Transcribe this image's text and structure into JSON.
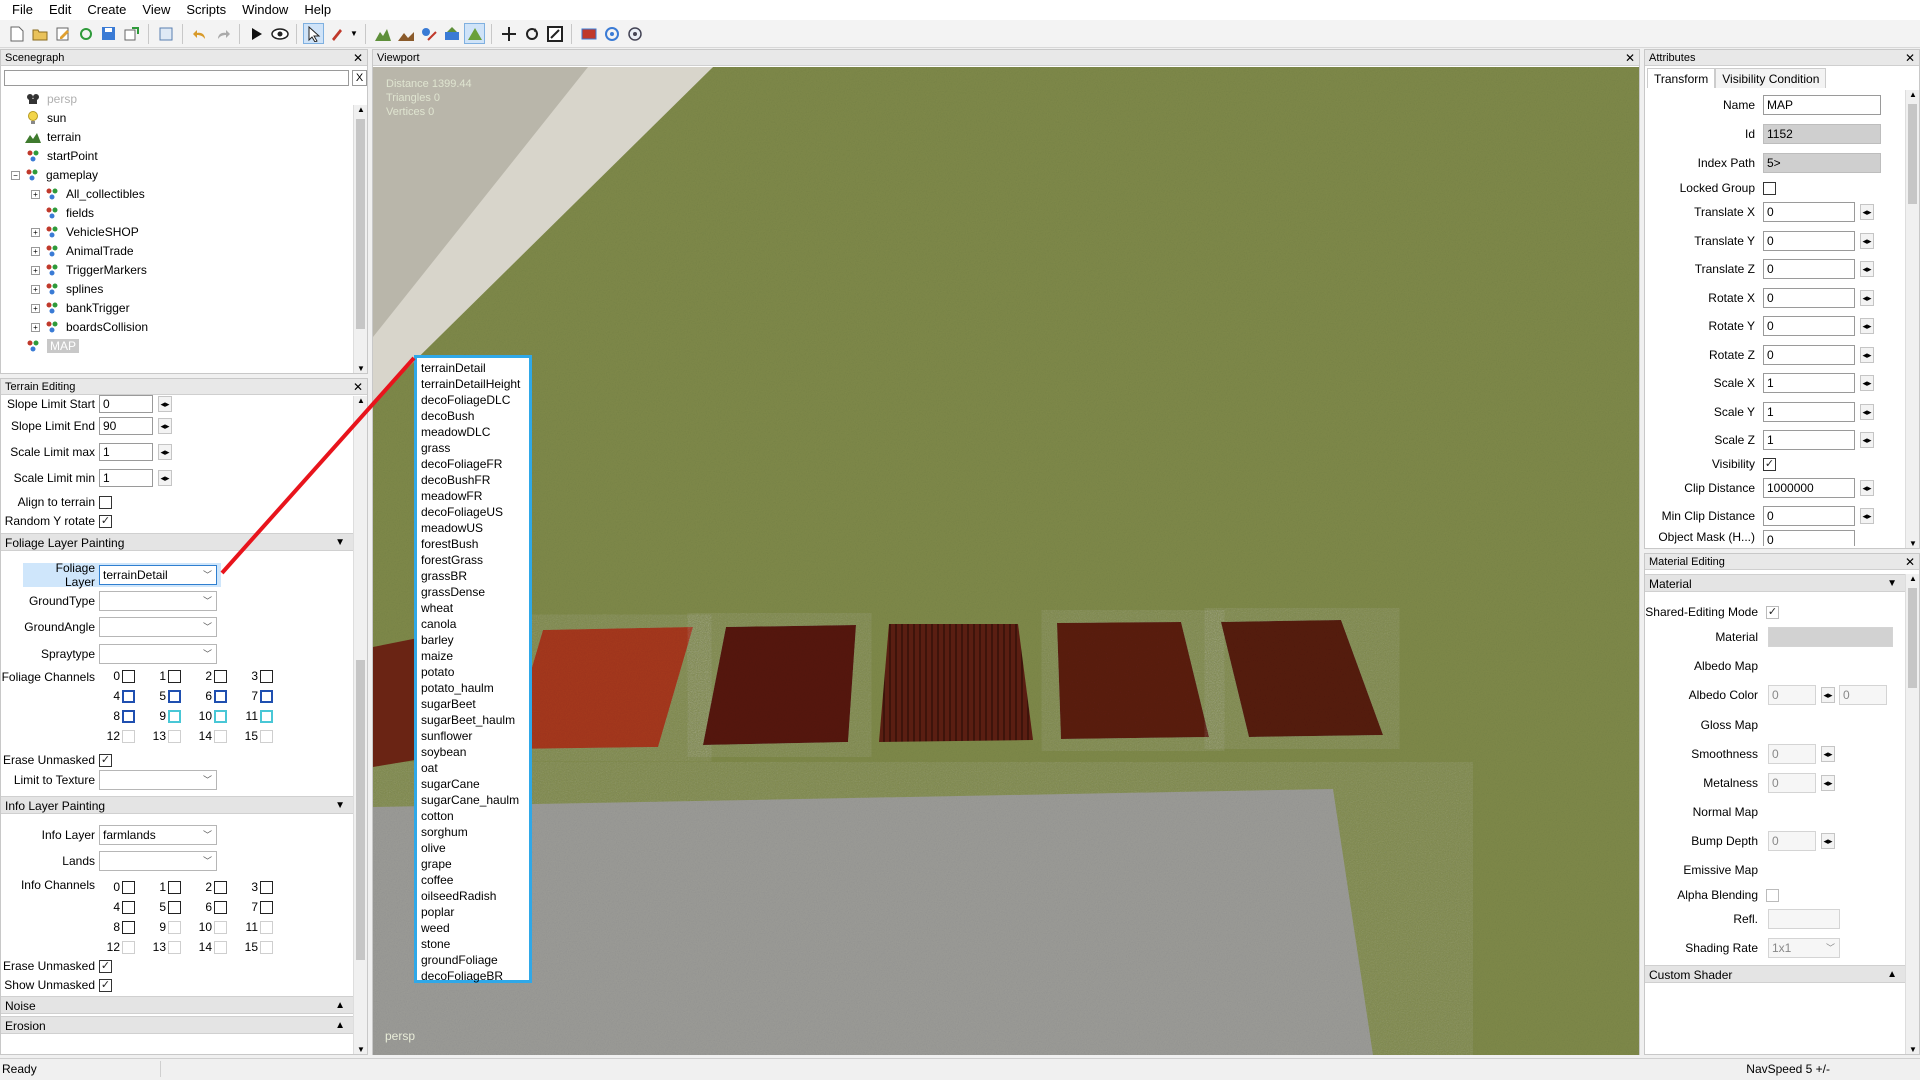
{
  "menu": [
    "File",
    "Edit",
    "Create",
    "View",
    "Scripts",
    "Window",
    "Help"
  ],
  "panels": {
    "scenegraph": "Scenegraph",
    "terrain_editing": "Terrain Editing",
    "viewport": "Viewport",
    "attributes": "Attributes",
    "material_editing": "Material Editing"
  },
  "scenegraph": {
    "clear_label": "X",
    "nodes": [
      "persp",
      "sun",
      "terrain",
      "startPoint",
      "gameplay",
      "All_collectibles",
      "fields",
      "VehicleSHOP",
      "AnimalTrade",
      "TriggerMarkers",
      "splines",
      "bankTrigger",
      "boardsCollision",
      "MAP"
    ]
  },
  "terrain": {
    "slope_limit_start": {
      "label": "Slope Limit Start",
      "value": "0"
    },
    "slope_limit_end": {
      "label": "Slope Limit End",
      "value": "90"
    },
    "scale_limit_max": {
      "label": "Scale Limit max",
      "value": "1"
    },
    "scale_limit_min": {
      "label": "Scale Limit min",
      "value": "1"
    },
    "align_to_terrain": "Align to terrain",
    "random_y_rotate": "Random Y rotate",
    "foliage_section": "Foliage Layer Painting",
    "foliage_layer": {
      "label": "Foliage Layer",
      "value": "terrainDetail"
    },
    "ground_type": "GroundType",
    "ground_angle": "GroundAngle",
    "spray_type": "Spraytype",
    "foliage_channels": "Foliage Channels",
    "erase_unmasked": "Erase Unmasked",
    "limit_to_texture": "Limit to Texture",
    "info_section": "Info Layer Painting",
    "info_layer": {
      "label": "Info Layer",
      "value": "farmlands"
    },
    "lands": "Lands",
    "info_channels": "Info Channels",
    "info_erase_unmasked": "Erase Unmasked",
    "show_unmasked": "Show Unmasked",
    "noise_section": "Noise",
    "erosion_section": "Erosion",
    "channel_numbers": [
      "0",
      "1",
      "2",
      "3",
      "4",
      "5",
      "6",
      "7",
      "8",
      "9",
      "10",
      "11",
      "12",
      "13",
      "14",
      "15"
    ]
  },
  "viewport": {
    "distance": "Distance 1399.44",
    "triangles": "Triangles 0",
    "vertices": "Vertices 0",
    "camera": "persp"
  },
  "foliage_options": [
    "terrainDetail",
    "terrainDetailHeight",
    "decoFoliageDLC",
    "decoBush",
    "meadowDLC",
    "grass",
    "decoFoliageFR",
    "decoBushFR",
    "meadowFR",
    "decoFoliageUS",
    "meadowUS",
    "forestBush",
    "forestGrass",
    "grassBR",
    "grassDense",
    "wheat",
    "canola",
    "barley",
    "maize",
    "potato",
    "potato_haulm",
    "sugarBeet",
    "sugarBeet_haulm",
    "sunflower",
    "soybean",
    "oat",
    "sugarCane",
    "sugarCane_haulm",
    "cotton",
    "sorghum",
    "olive",
    "grape",
    "coffee",
    "oilseedRadish",
    "poplar",
    "weed",
    "stone",
    "groundFoliage",
    "decoFoliageBR"
  ],
  "attributes": {
    "tabs": [
      "Transform",
      "Visibility Condition"
    ],
    "name": {
      "label": "Name",
      "value": "MAP"
    },
    "id": {
      "label": "Id",
      "value": "1152"
    },
    "index_path": {
      "label": "Index Path",
      "value": "5>"
    },
    "locked_group": "Locked Group",
    "translate_x": {
      "label": "Translate X",
      "value": "0"
    },
    "translate_y": {
      "label": "Translate Y",
      "value": "0"
    },
    "translate_z": {
      "label": "Translate Z",
      "value": "0"
    },
    "rotate_x": {
      "label": "Rotate X",
      "value": "0"
    },
    "rotate_y": {
      "label": "Rotate Y",
      "value": "0"
    },
    "rotate_z": {
      "label": "Rotate Z",
      "value": "0"
    },
    "scale_x": {
      "label": "Scale X",
      "value": "1"
    },
    "scale_y": {
      "label": "Scale Y",
      "value": "1"
    },
    "scale_z": {
      "label": "Scale Z",
      "value": "1"
    },
    "visibility": "Visibility",
    "clip_distance": {
      "label": "Clip Distance",
      "value": "1000000"
    },
    "min_clip_distance": {
      "label": "Min Clip Distance",
      "value": "0"
    },
    "object_mask": {
      "label": "Object Mask (H...)",
      "value": "0"
    }
  },
  "material": {
    "section": "Material",
    "shared_editing": "Shared-Editing Mode",
    "material": "Material",
    "albedo_map": "Albedo Map",
    "albedo_color": {
      "label": "Albedo Color",
      "value1": "0",
      "value2": "0"
    },
    "gloss_map": "Gloss Map",
    "smoothness": {
      "label": "Smoothness",
      "value": "0"
    },
    "metalness": {
      "label": "Metalness",
      "value": "0"
    },
    "normal_map": "Normal Map",
    "bump_depth": {
      "label": "Bump Depth",
      "value": "0"
    },
    "emissive_map": "Emissive Map",
    "alpha_blending": "Alpha Blending",
    "refl": "Refl.",
    "shading_rate": {
      "label": "Shading Rate",
      "value": "1x1"
    },
    "custom_shader": "Custom Shader"
  },
  "status": {
    "left": "Ready",
    "right": "NavSpeed 5 +/-"
  },
  "colors": {
    "accent": "#2fa8e8",
    "annotation": "#e8141c",
    "grass": "#7f8a4a"
  }
}
